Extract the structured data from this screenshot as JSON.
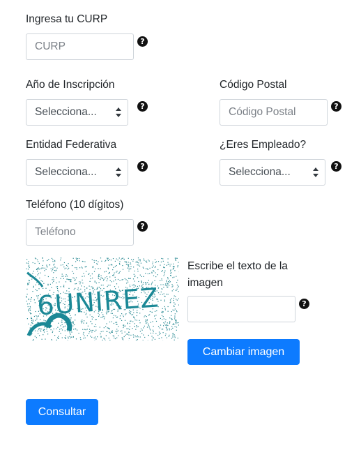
{
  "curp": {
    "label": "Ingresa tu CURP",
    "placeholder": "CURP",
    "help_icon": "question-circle-icon"
  },
  "anio": {
    "label": "Año de Inscripción",
    "selected": "Selecciona..."
  },
  "codigo_postal": {
    "label": "Código Postal",
    "placeholder": "Código Postal"
  },
  "entidad": {
    "label": "Entidad Federativa",
    "selected": "Selecciona..."
  },
  "empleado": {
    "label": "¿Eres Empleado?",
    "selected": "Selecciona..."
  },
  "telefono": {
    "label": "Teléfono (10 dígitos)",
    "placeholder": "Teléfono"
  },
  "captcha": {
    "image_text": "6UNIREZ",
    "label": "Escribe el texto de la imagen",
    "label_line1": "Escribe el texto de la",
    "label_line2": "imagen",
    "input_value": "",
    "change_button": "Cambiar imagen",
    "colors": {
      "text": "#1b8896",
      "noise": "#2a8a93"
    }
  },
  "submit_button": "Consultar",
  "help_glyph": "?",
  "colors": {
    "primary": "#0d7bff",
    "border": "#ced4da"
  }
}
